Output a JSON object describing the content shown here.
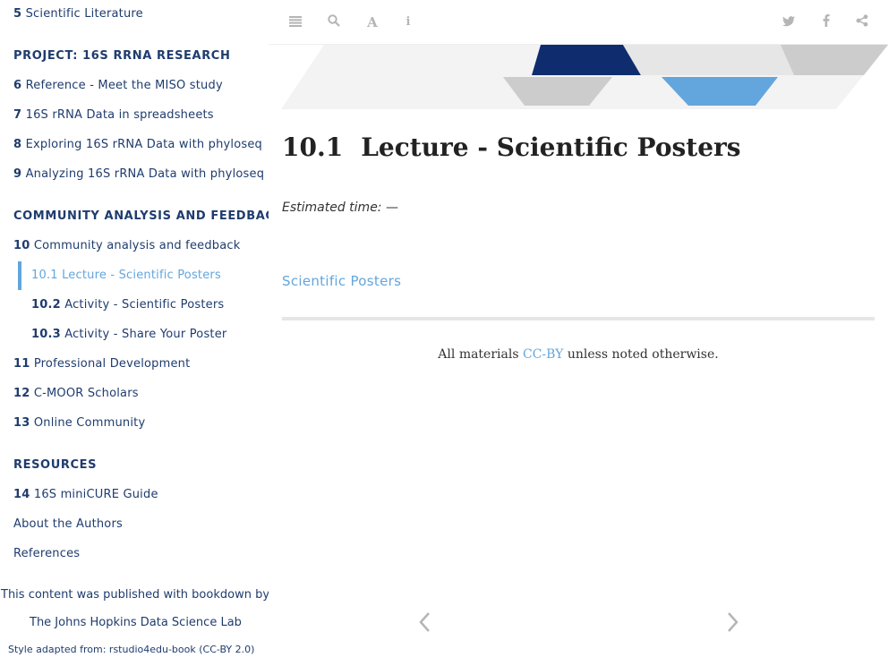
{
  "sidebar": {
    "items": [
      {
        "num": "5",
        "label": "Scientific Literature"
      },
      {
        "header": "PROJECT: 16S RRNA RESEARCH"
      },
      {
        "num": "6",
        "label": "Reference - Meet the MISO study"
      },
      {
        "num": "7",
        "label": "16S rRNA Data in spreadsheets"
      },
      {
        "num": "8",
        "label": "Exploring 16S rRNA Data with phyloseq"
      },
      {
        "num": "9",
        "label": "Analyzing 16S rRNA Data with phyloseq"
      },
      {
        "header": "COMMUNITY ANALYSIS AND FEEDBACK"
      },
      {
        "num": "10",
        "label": "Community analysis and feedback"
      },
      {
        "num": "10.1",
        "label": "Lecture - Scientific Posters"
      },
      {
        "num": "10.2",
        "label": "Activity - Scientific Posters"
      },
      {
        "num": "10.3",
        "label": "Activity - Share Your Poster"
      },
      {
        "num": "11",
        "label": "Professional Development"
      },
      {
        "num": "12",
        "label": "C-MOOR Scholars"
      },
      {
        "num": "13",
        "label": "Online Community"
      },
      {
        "header": "RESOURCES"
      },
      {
        "num": "14",
        "label": "16S miniCURE Guide"
      },
      {
        "label": "About the Authors"
      },
      {
        "label": "References"
      }
    ],
    "footer": {
      "published": "This content was published with bookdown by:",
      "lab": "The Johns Hopkins Data Science Lab",
      "style": "Style adapted from: rstudio4edu-book (CC-BY 2.0)"
    }
  },
  "toolbar": {
    "left_icons": [
      "menu-icon",
      "search-icon",
      "font-icon",
      "info-icon"
    ],
    "right_icons": [
      "twitter-icon",
      "facebook-icon",
      "share-icon"
    ]
  },
  "main": {
    "section_number": "10.1",
    "title": "Lecture - Scientific Posters",
    "estimated_time": "Estimated time: —",
    "link": "Scientific Posters",
    "materials_prefix": "All materials ",
    "materials_link": "CC-BY",
    "materials_suffix": " unless noted otherwise."
  },
  "nav": {
    "prev_icon": "chevron-left-icon",
    "next_icon": "chevron-right-icon"
  },
  "colors": {
    "navy": "#1f3c6e",
    "accent_blue": "#63a6dd",
    "banner_dark": "#0f2d6e",
    "banner_grey": "#cccccc",
    "banner_light": "#e6e6e6"
  }
}
